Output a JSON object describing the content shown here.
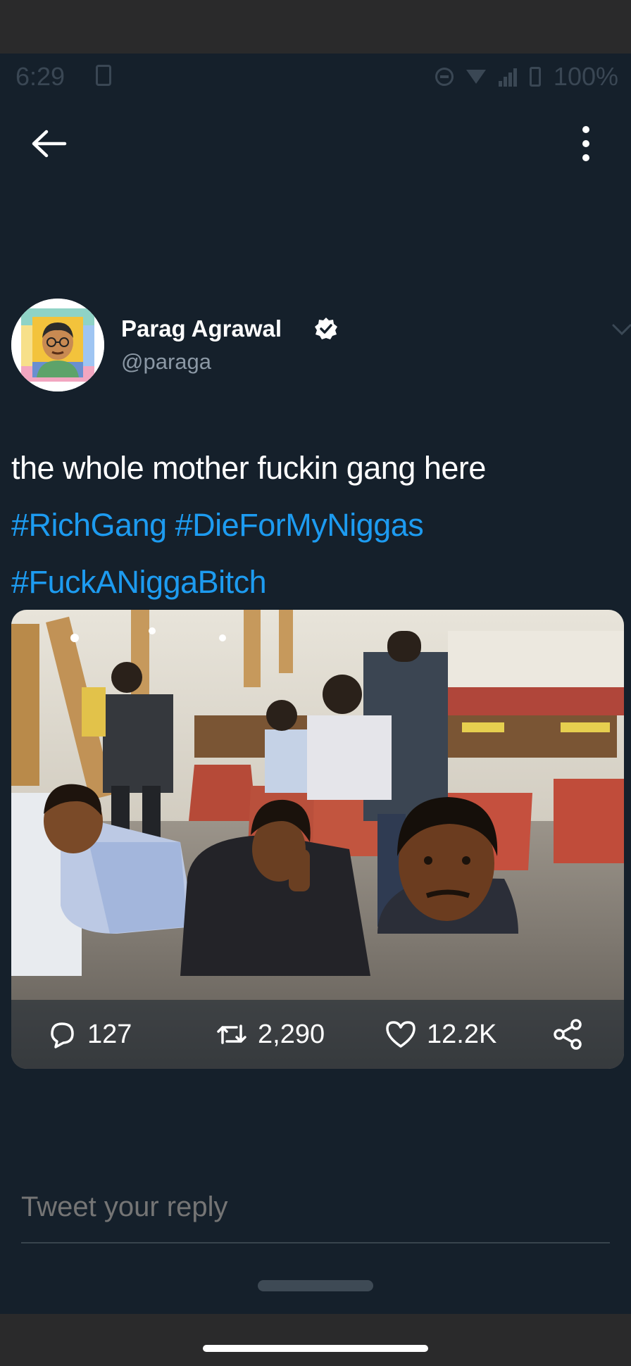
{
  "status_bar": {
    "time": "6:29",
    "battery": "100%"
  },
  "header": {
    "back_icon": "arrow-left-icon",
    "more_icon": "more-vertical-icon"
  },
  "tweet": {
    "author_name": "Parag Agrawal",
    "author_handle": "@paraga",
    "verified": true,
    "text_line1": "the whole mother fuckin gang here",
    "hashtag1": "#RichGang",
    "hashtag2": "#DieForMyNiggas",
    "hashtag3": "#FuckANiggaBitch",
    "media_icon": "photo",
    "stats": {
      "replies": "127",
      "retweets": "2,290",
      "likes": "12.2K"
    }
  },
  "reply": {
    "placeholder": "Tweet your reply"
  },
  "colors": {
    "background": "#15202b",
    "link": "#1d9bf0",
    "secondary_text": "#8b98a5"
  }
}
